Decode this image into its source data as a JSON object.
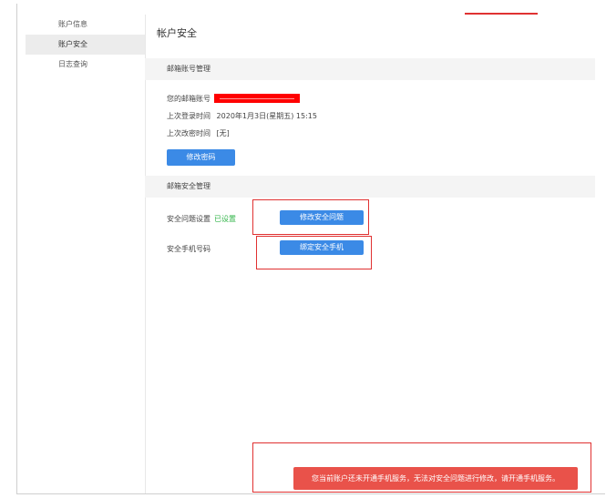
{
  "sidebar": {
    "items": [
      {
        "label": "账户信息"
      },
      {
        "label": "账户安全"
      },
      {
        "label": "日志查询"
      }
    ]
  },
  "main": {
    "title": "帐户安全",
    "email_section": {
      "heading": "邮箱账号管理",
      "email_label": "您的邮箱账号",
      "last_login_label": "上次登录时间",
      "last_login_value": "2020年1月3日(星期五) 15:15",
      "last_pwd_change_label": "上次改密时间",
      "last_pwd_change_value": "[无]",
      "change_password_button": "修改密码"
    },
    "security_section": {
      "heading": "邮箱安全管理",
      "question_label": "安全问题设置",
      "question_status": "已设置",
      "modify_question_button": "修改安全问题",
      "phone_label": "安全手机号码",
      "bind_phone_button": "绑定安全手机"
    }
  },
  "toast": {
    "message": "您当前账户还未开通手机服务，无法对安全问题进行修改，请开通手机服务。"
  },
  "colors": {
    "primary_button": "#3b8ae6",
    "highlight_red": "#e03131",
    "toast_bg": "#e9524a",
    "status_green": "#33b54a"
  }
}
